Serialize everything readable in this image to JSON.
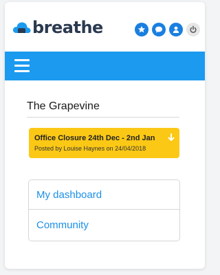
{
  "brand": {
    "name": "breathe",
    "logo_icon": "cloud-logo-icon",
    "accent_color": "#1b9aef",
    "text_color": "#2b3a50"
  },
  "header": {
    "icons": [
      {
        "name": "star-icon",
        "color": "#1a7fe0"
      },
      {
        "name": "chat-icon",
        "color": "#1a7fe0"
      },
      {
        "name": "user-icon",
        "color": "#1a7fe0"
      },
      {
        "name": "power-icon",
        "color": "#e6e6e6"
      }
    ]
  },
  "navbar": {
    "menu_icon": "hamburger-menu-icon",
    "color": "#1b9aef"
  },
  "grapevine": {
    "title": "The Grapevine",
    "notice": {
      "title": "Office Closure 24th Dec - 2nd Jan",
      "subtitle": "Posted by Louise Haynes on 24/04/2018",
      "icon": "arrow-down-icon",
      "color": "#fbc816"
    }
  },
  "links": [
    {
      "label": "My dashboard"
    },
    {
      "label": "Community"
    }
  ]
}
